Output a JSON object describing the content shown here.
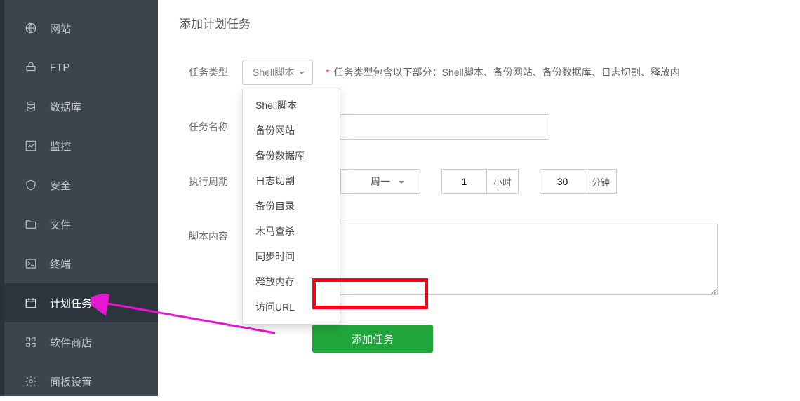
{
  "sidebar": {
    "items": [
      {
        "label": "网站",
        "icon": "globe-icon"
      },
      {
        "label": "FTP",
        "icon": "ftp-icon"
      },
      {
        "label": "数据库",
        "icon": "database-icon"
      },
      {
        "label": "监控",
        "icon": "chart-icon"
      },
      {
        "label": "安全",
        "icon": "shield-icon"
      },
      {
        "label": "文件",
        "icon": "folder-icon"
      },
      {
        "label": "终端",
        "icon": "terminal-icon"
      },
      {
        "label": "计划任务",
        "icon": "calendar-icon"
      },
      {
        "label": "软件商店",
        "icon": "grid-icon"
      },
      {
        "label": "面板设置",
        "icon": "gear-icon"
      }
    ]
  },
  "page": {
    "title": "添加计划任务"
  },
  "form": {
    "task_type_label": "任务类型",
    "task_type_selected": "Shell脚本",
    "task_type_hint_marker": "*",
    "task_type_hint": "任务类型包含以下部分：Shell脚本、备份网站、备份数据库、日志切割、释放内",
    "task_type_options": [
      "Shell脚本",
      "备份网站",
      "备份数据库",
      "日志切割",
      "备份目录",
      "木马查杀",
      "同步时间",
      "释放内存",
      "访问URL"
    ],
    "task_name_label": "任务名称",
    "task_name_value": "",
    "cycle_label": "执行周期",
    "cycle_week": "周一",
    "cycle_hour": "1",
    "cycle_hour_unit": "小时",
    "cycle_min": "30",
    "cycle_min_unit": "分钟",
    "script_label": "脚本内容",
    "script_value": "",
    "submit_label": "添加任务"
  },
  "colors": {
    "sidebar_bg": "#3c444d",
    "accent": "#20a53a",
    "highlight": "#ff0016",
    "arrow": "#e815d2"
  }
}
